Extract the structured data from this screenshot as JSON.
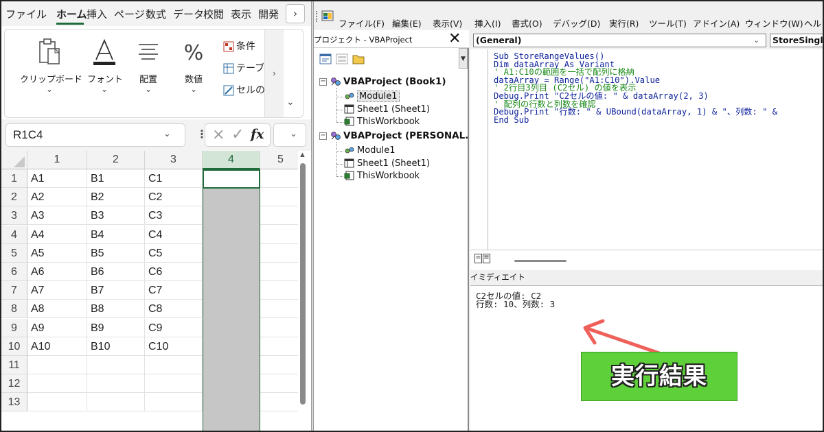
{
  "excel": {
    "tabs": [
      "ファイル",
      "ホーム",
      "挿入",
      "ページ",
      "数式",
      "データ",
      "校閲",
      "表示",
      "開発"
    ],
    "tab_more": "›",
    "ribbon": {
      "clipboard": "クリップボード",
      "font": "フォント",
      "alignment": "配置",
      "number": "数値",
      "chev": "⌄",
      "styles": [
        "条件",
        "テーブ",
        "セルの"
      ],
      "scroll_right": "›",
      "collapse": "⌄"
    },
    "name_box": "R1C4",
    "fx": "fx",
    "columns": [
      "1",
      "2",
      "3",
      "4",
      "5"
    ],
    "rows": [
      {
        "n": "1",
        "c": [
          "A1",
          "B1",
          "C1"
        ]
      },
      {
        "n": "2",
        "c": [
          "A2",
          "B2",
          "C2"
        ]
      },
      {
        "n": "3",
        "c": [
          "A3",
          "B3",
          "C3"
        ]
      },
      {
        "n": "4",
        "c": [
          "A4",
          "B4",
          "C4"
        ]
      },
      {
        "n": "5",
        "c": [
          "A5",
          "B5",
          "C5"
        ]
      },
      {
        "n": "6",
        "c": [
          "A6",
          "B6",
          "C6"
        ]
      },
      {
        "n": "7",
        "c": [
          "A7",
          "B7",
          "C7"
        ]
      },
      {
        "n": "8",
        "c": [
          "A8",
          "B8",
          "C8"
        ]
      },
      {
        "n": "9",
        "c": [
          "A9",
          "B9",
          "C9"
        ]
      },
      {
        "n": "10",
        "c": [
          "A10",
          "B10",
          "C10"
        ]
      },
      {
        "n": "11",
        "c": [
          "",
          "",
          ""
        ]
      },
      {
        "n": "12",
        "c": [
          "",
          "",
          ""
        ]
      },
      {
        "n": "13",
        "c": [
          "",
          "",
          ""
        ]
      }
    ],
    "selected_column": "4"
  },
  "vbe": {
    "menus": [
      "ファイル(F)",
      "編集(E)",
      "表示(V)",
      "挿入(I)",
      "書式(O)",
      "デバッグ(D)",
      "実行(R)",
      "ツール(T)",
      "アドイン(A)",
      "ウィンドウ(W)",
      "ヘル"
    ],
    "project": {
      "title": "プロジェクト - VBAProject",
      "close": "✕",
      "tree": [
        {
          "label": "VBAProject (Book1)",
          "kind": "project"
        },
        {
          "label": "Module1",
          "kind": "module",
          "selected": true
        },
        {
          "label": "Sheet1 (Sheet1)",
          "kind": "sheet"
        },
        {
          "label": "ThisWorkbook",
          "kind": "workbook"
        },
        {
          "label": "VBAProject (PERSONAL.",
          "kind": "project"
        },
        {
          "label": "Module1",
          "kind": "module"
        },
        {
          "label": "Sheet1 (Sheet1)",
          "kind": "sheet"
        },
        {
          "label": "ThisWorkbook",
          "kind": "workbook"
        }
      ]
    },
    "code": {
      "object_combo": "(General)",
      "procedure_combo": "StoreSingl",
      "lines": [
        {
          "t": "Sub StoreRangeValues()",
          "comment": false
        },
        {
          "t": "Dim dataArray As Variant",
          "comment": false
        },
        {
          "t": "' A1:C10の範囲を一括で配列に格納",
          "comment": true
        },
        {
          "t": "dataArray = Range(\"A1:C10\").Value",
          "comment": false
        },
        {
          "t": "' 2行目3列目 (C2セル) の値を表示",
          "comment": true
        },
        {
          "t": "Debug.Print \"C2セルの値: \" & dataArray(2, 3)",
          "comment": false
        },
        {
          "t": "' 配列の行数と列数を確認",
          "comment": true
        },
        {
          "t": "Debug.Print \"行数: \" & UBound(dataArray, 1) & \"、列数: \" &",
          "comment": false
        },
        {
          "t": "End Sub",
          "comment": false
        }
      ]
    },
    "immediate": {
      "title": "イミディエイト",
      "lines": [
        "C2セルの値: C2",
        "行数: 10、列数: 3"
      ]
    }
  },
  "annotation": {
    "label": "実行結果",
    "box_color": "#5ed13a",
    "arrow_color": "#f0605a"
  }
}
